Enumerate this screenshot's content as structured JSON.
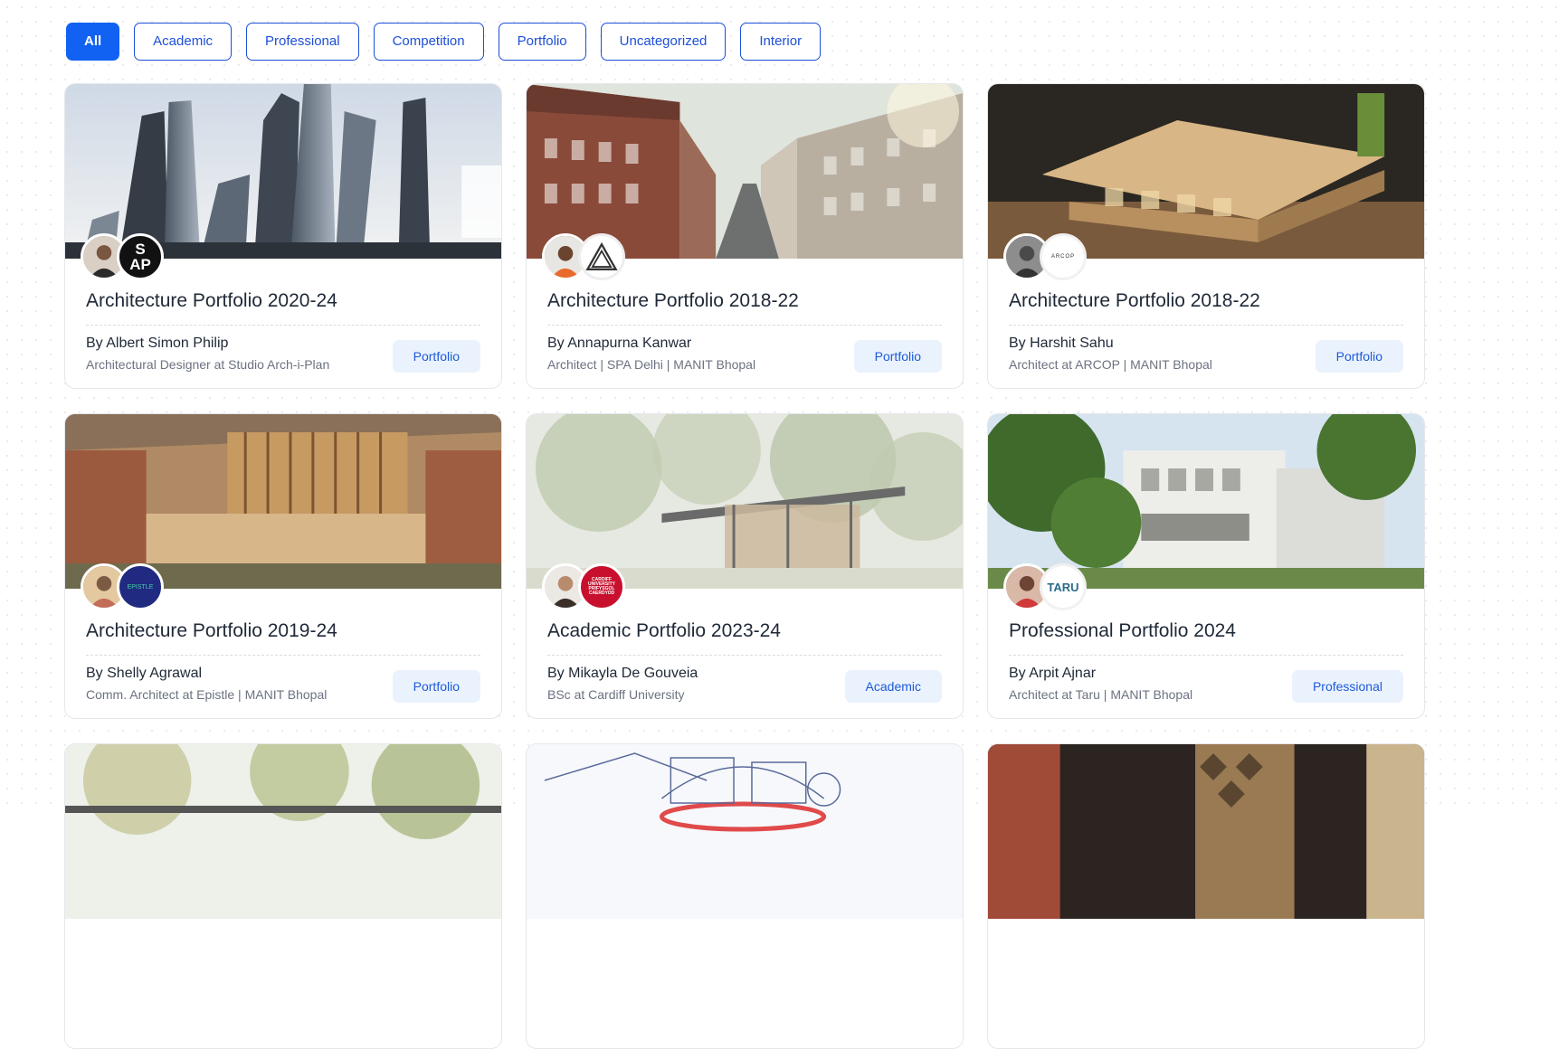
{
  "filters": [
    {
      "label": "All",
      "active": true
    },
    {
      "label": "Academic",
      "active": false
    },
    {
      "label": "Professional",
      "active": false
    },
    {
      "label": "Competition",
      "active": false
    },
    {
      "label": "Portfolio",
      "active": false
    },
    {
      "label": "Uncategorized",
      "active": false
    },
    {
      "label": "Interior",
      "active": false
    }
  ],
  "cards": [
    {
      "title": "Architecture Portfolio 2020-24",
      "author": "By Albert Simon Philip",
      "role": "Architectural Designer at Studio Arch-i-Plan",
      "tag": "Portfolio",
      "logo_text": "S\nAP",
      "thumb": "skyscrapers"
    },
    {
      "title": "Architecture Portfolio 2018-22",
      "author": "By Annapurna Kanwar",
      "role": "Architect | SPA Delhi | MANIT Bhopal",
      "tag": "Portfolio",
      "logo_text": "",
      "thumb": "street"
    },
    {
      "title": "Architecture Portfolio 2018-22",
      "author": "By Harshit Sahu",
      "role": "Architect at ARCOP | MANIT Bhopal",
      "tag": "Portfolio",
      "logo_text": "ARCOP",
      "thumb": "model"
    },
    {
      "title": "Architecture Portfolio 2019-24",
      "author": "By Shelly Agrawal",
      "role": "Comm. Architect at Epistle | MANIT Bhopal",
      "tag": "Portfolio",
      "logo_text": "EPISTLE",
      "thumb": "brick"
    },
    {
      "title": "Academic Portfolio 2023-24",
      "author": "By Mikayla De Gouveia",
      "role": "BSc at Cardiff University",
      "tag": "Academic",
      "logo_text": "CARDIFF UNIVERSITY PRIFYSGOL CAERDYDD",
      "thumb": "pavilion"
    },
    {
      "title": "Professional Portfolio 2024",
      "author": "By Arpit Ajnar",
      "role": "Architect at Taru | MANIT Bhopal",
      "tag": "Professional",
      "logo_text": "TARU",
      "thumb": "villa"
    },
    {
      "title": "",
      "author": "",
      "role": "",
      "tag": "",
      "logo_text": "",
      "thumb": "trees"
    },
    {
      "title": "",
      "author": "",
      "role": "",
      "tag": "",
      "logo_text": "",
      "thumb": "sketch"
    },
    {
      "title": "",
      "author": "",
      "role": "",
      "tag": "",
      "logo_text": "",
      "thumb": "interior"
    }
  ],
  "colors": {
    "accent": "#1162f2",
    "tag_bg": "#eaf2fd",
    "tag_text": "#1d5ad8"
  }
}
